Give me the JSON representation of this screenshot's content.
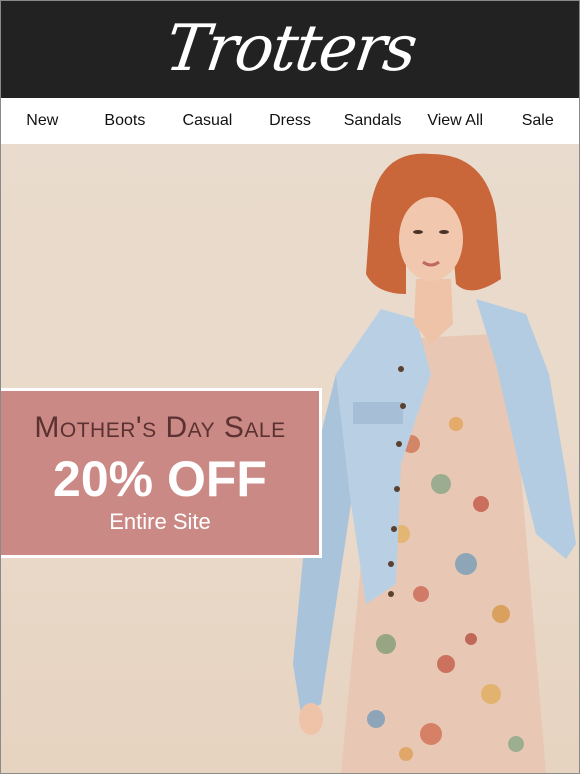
{
  "brand": {
    "logo_text": "Trotters"
  },
  "nav": {
    "items": [
      "New",
      "Boots",
      "Casual",
      "Dress",
      "Sandals",
      "View All",
      "Sale"
    ]
  },
  "hero": {
    "promo": {
      "title": "Mother's Day Sale",
      "discount": "20% OFF",
      "subtitle": "Entire Site"
    },
    "image": "woman-in-denim-jacket-and-floral-dress"
  },
  "colors": {
    "header_bg": "#222222",
    "promo_bg": "#cb8985",
    "promo_title": "#5b3131",
    "hero_bg": "#e9dbcd"
  }
}
